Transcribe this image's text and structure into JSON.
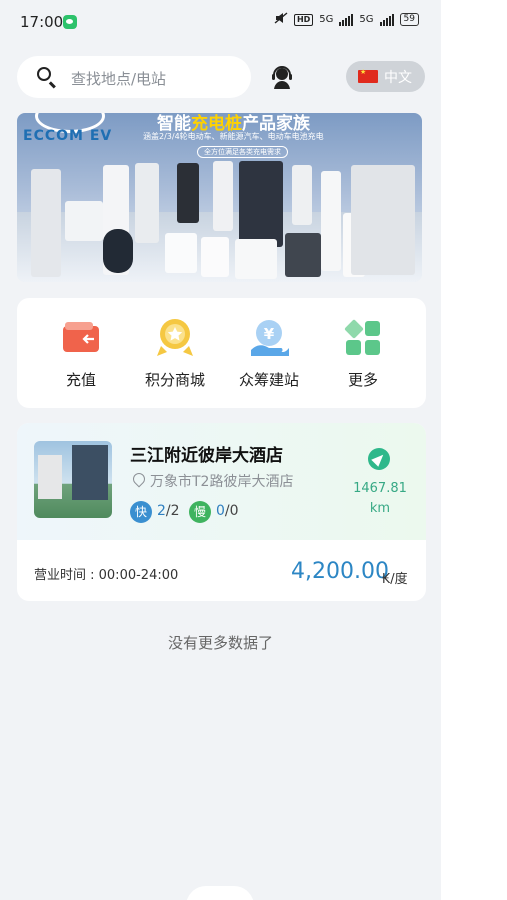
{
  "status_bar": {
    "time": "17:00",
    "hd": "HD",
    "net1": "5G",
    "net2": "5G",
    "battery": "59"
  },
  "search": {
    "placeholder": "查找地点/电站"
  },
  "language": {
    "label": "中文"
  },
  "banner": {
    "brand": "ECCOM EV",
    "headline_a": "智能",
    "headline_b": "充电桩",
    "headline_c": "产品家族",
    "subline": "涵盖2/3/4轮电动车、新能源汽车、电动车电池充电",
    "tagline": "全方位满足各类充电需求"
  },
  "menu": {
    "items": [
      {
        "label": "充值",
        "icon": "wallet-icon",
        "color": "#f0634b"
      },
      {
        "label": "积分商城",
        "icon": "medal-icon",
        "color": "#f5c842"
      },
      {
        "label": "众筹建站",
        "icon": "yuan-hand-icon",
        "color": "#5aa7e8"
      },
      {
        "label": "更多",
        "icon": "grid-icon",
        "color": "#5cc78a"
      }
    ]
  },
  "station": {
    "name": "三江附近彼岸大酒店",
    "address": "万象市T2路彼岸大酒店",
    "fast_label": "快",
    "fast_available": "2",
    "fast_total": "/2",
    "slow_label": "慢",
    "slow_available": "0",
    "slow_total": "/0",
    "distance": "1467.81",
    "distance_unit": "km",
    "hours": "营业时间 : 00:00-24:00",
    "price": "4,200.00",
    "price_unit": "₭/度",
    "fast_color": "#3a8fd0",
    "slow_color": "#3fb35f"
  },
  "footer": {
    "no_more": "没有更多数据了"
  }
}
